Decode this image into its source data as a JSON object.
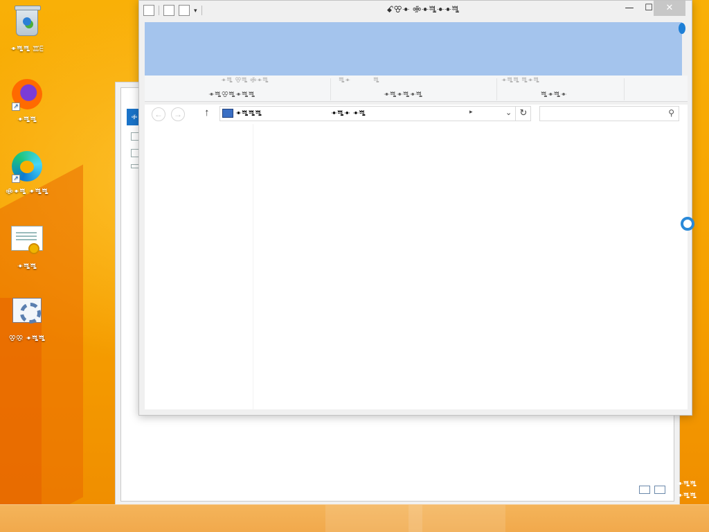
{
  "desktop": {
    "icons": [
      {
        "id": "recycle",
        "label": "ꔹꗀꗀ ꕭꗋ"
      },
      {
        "id": "firefox",
        "label": "ꔹꗀꗀ"
      },
      {
        "id": "edge",
        "label": "ꗂꔹꗀ ꔹꗀꗀ"
      },
      {
        "id": "certificate",
        "label": "ꔹꗀꗀ"
      },
      {
        "id": "control-panel",
        "label": "ꕢꕣ ꔹꗀꗀ"
      }
    ],
    "clock": {
      "time": "ꔹꗀꗀ",
      "date": "ꔹꗀꗀ"
    }
  },
  "window": {
    "title": "ꗃꕢꔹ  ꗂꔹꗀꔹꔹꗀ",
    "controls": {
      "minimize": "—",
      "maximize": "☐",
      "close": "✕"
    },
    "ribbon": {
      "faint_row": [
        "ꔹꗀ ꕢꗀ ꗂꔹꗀ",
        "ꗀꔹ",
        "ꗀ",
        "ꔹꗀꗀ ꗀꔹꗀ"
      ],
      "groups": [
        "ꔹꗀꕢꗀꔹꗀꗀ",
        "ꔹꗀꔹꗀꔹꗀ",
        "ꗀꔹꗀꔹ"
      ]
    },
    "address": {
      "location": "ꔹꗀꗀꗀ",
      "path_part": "ꔹꗀꔹ ꔹꗀ",
      "refresh": "↻",
      "dropdown": "⌄",
      "up": "↑"
    },
    "search": {
      "placeholder": ""
    }
  },
  "background_window": {
    "tab_label": "ꗂ"
  },
  "colors": {
    "ribbon_highlight": "#a4c4ed",
    "desktop_orange": "#f7a300",
    "busy_ring": "#2a89d8"
  }
}
